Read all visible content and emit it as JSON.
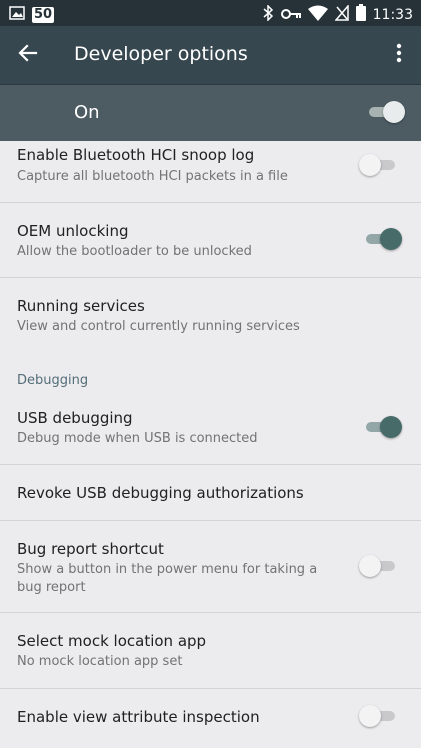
{
  "status_bar": {
    "time": "11:33",
    "badge": "50",
    "icons": [
      "image-icon",
      "bluetooth-icon",
      "key-icon",
      "wifi-icon",
      "no-sim-icon",
      "battery-icon"
    ]
  },
  "app_bar": {
    "title": "Developer options",
    "back_icon": "arrow-left-icon",
    "menu_icon": "more-vert-icon"
  },
  "master": {
    "label": "On",
    "enabled": true
  },
  "section_header": "Debugging",
  "items": [
    {
      "title": "Enable Bluetooth HCI snoop log",
      "subtitle": "Capture all bluetooth HCI packets in a file",
      "has_switch": true,
      "checked": false
    },
    {
      "title": "OEM unlocking",
      "subtitle": "Allow the bootloader to be unlocked",
      "has_switch": true,
      "checked": true
    },
    {
      "title": "Running services",
      "subtitle": "View and control currently running services",
      "has_switch": false
    },
    {
      "title": "USB debugging",
      "subtitle": "Debug mode when USB is connected",
      "has_switch": true,
      "checked": true
    },
    {
      "title": "Revoke USB debugging authorizations",
      "has_switch": false
    },
    {
      "title": "Bug report shortcut",
      "subtitle": "Show a button in the power menu for taking a bug report",
      "has_switch": true,
      "checked": false
    },
    {
      "title": "Select mock location app",
      "subtitle": "No mock location app set",
      "has_switch": false
    },
    {
      "title": "Enable view attribute inspection",
      "has_switch": true,
      "checked": false
    }
  ],
  "colors": {
    "status_bar": "#263238",
    "app_bar": "#37474f",
    "master_bar": "#4d5c63",
    "background": "#ecebee",
    "accent": "#466b68",
    "section_header": "#546e7a"
  }
}
